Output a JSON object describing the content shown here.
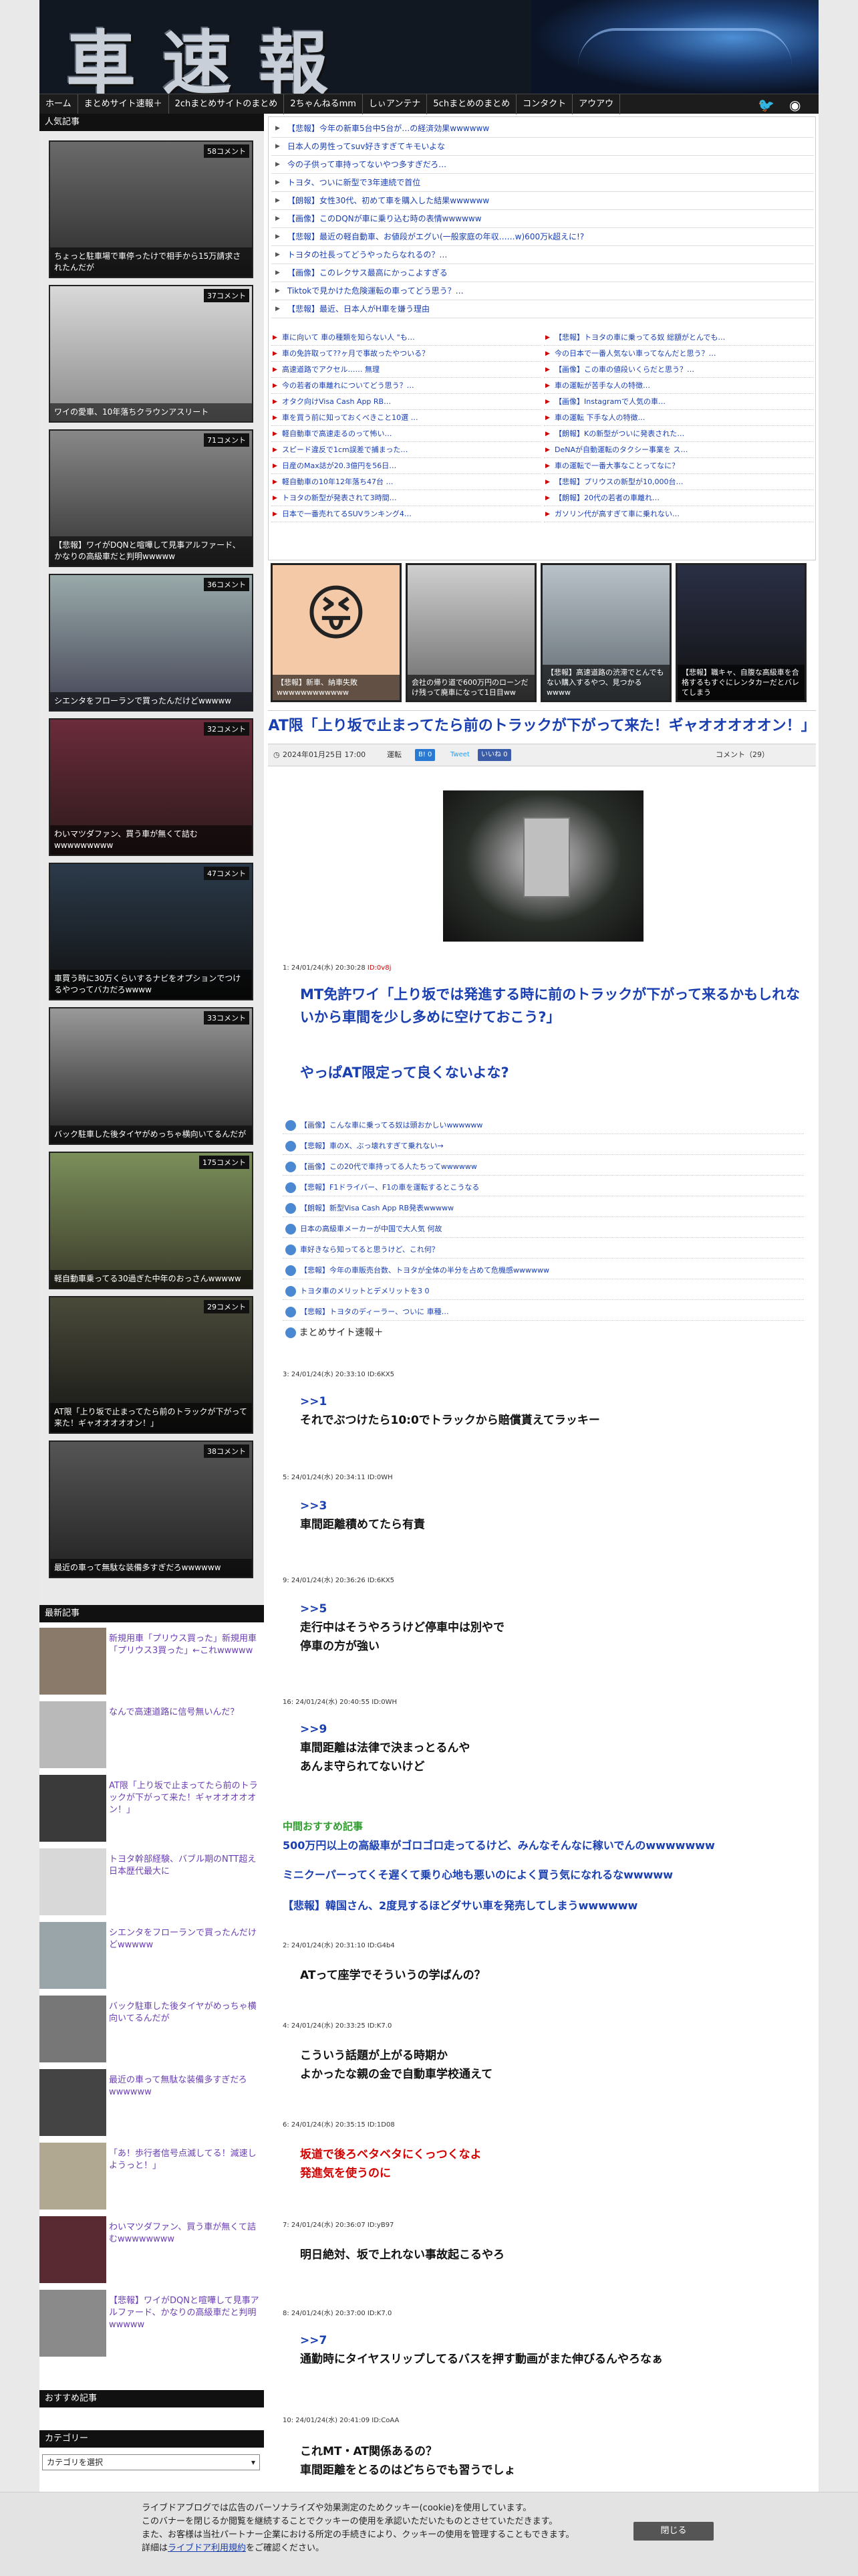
{
  "site": {
    "title": "車速報"
  },
  "nav": [
    "ホーム",
    "まとめサイト速報＋",
    "2chまとめサイトのまとめ",
    "2ちゃんねるmm",
    "しぃアンテナ",
    "5chまとめのまとめ",
    "コンタクト",
    "アウアウ"
  ],
  "ranking": {
    "heading": "人気記事",
    "items": [
      {
        "count": "58コメント",
        "caption": "ちょっと駐車場で車停ったけで相手から15万請求されたんだが"
      },
      {
        "count": "37コメント",
        "caption": "ワイの愛車、10年落ちクラウンアスリート"
      },
      {
        "count": "71コメント",
        "caption": "【悲報】ワイがDQNと喧嘩して見事アルファード、かなりの高級車だと判明wwwww"
      },
      {
        "count": "36コメント",
        "caption": "シエンタをフローランで買ったんだけどwwwww"
      },
      {
        "count": "32コメント",
        "caption": "わいマツダファン、買う車が無くて詰むwwwwwwwww"
      },
      {
        "count": "47コメント",
        "caption": "車買う時に30万くらいするナビをオプションでつけるやつってバカだろwwww"
      },
      {
        "count": "33コメント",
        "caption": "バック駐車した後タイヤがめっちゃ横向いてるんだが"
      },
      {
        "count": "175コメント",
        "caption": "軽自動車乗ってる30過ぎた中年のおっさんwwwww"
      },
      {
        "count": "29コメント",
        "caption": "AT限「上り坂で止まってたら前のトラックが下がって来た！ギャオオオオオン！」"
      },
      {
        "count": "38コメント",
        "caption": "最近の車って無駄な装備多すぎだろwwwwww"
      }
    ]
  },
  "latest": {
    "heading": "最新記事",
    "items": [
      "新規用車「プリウス買った」新規用車「プリウス3買った」←これwwwww",
      "なんで高速道路に信号無いんだ？",
      "AT限「上り坂で止まってたら前のトラックが下がって来た！ギャオオオオオン！」",
      "トヨタ幹部経験、バブル期のNTT超え日本歴代最大に",
      "シエンタをフローランで買ったんだけどwwwww",
      "バック駐車した後タイヤがめっちゃ横向いてるんだが",
      "最近の車って無駄な装備多すぎだろwwwwww",
      "「あ！歩行者信号点滅してる！減速しようっと！」",
      "わいマツダファン、買う車が無くて詰むwwwwwwww",
      "【悲報】ワイがDQNと喧嘩して見事アルファード、かなりの高級車だと判明wwwww"
    ]
  },
  "recommend_heading": "おすすめ記事",
  "category": {
    "heading": "カテゴリー",
    "select": "カテゴリを選択"
  },
  "list1": [
    "【悲報】今年の新車5台中5台が…の経済効果wwwwww",
    "日本人の男性ってsuv好きすぎてキモいよな",
    "今の子供って車持ってないやつ多すぎだろ…",
    "トヨタ、ついに新型で3年連続で首位",
    "【朗報】女性30代、初めて車を購入した結果wwwwww",
    "【画像】このDQNが車に乗り込む時の表情wwwwww",
    "【悲報】最近の軽自動車、お値段がエグい(一般家庭の年収……w)600万k超えに!?",
    "トヨタの社長ってどうやったらなれるの？…",
    "【画像】このレクサス最高にかっこよすぎる",
    "Tiktokで見かけた危険運転の車ってどう思う？…",
    "【悲報】最近、日本人がH車を嫌う理由"
  ],
  "list2_left": [
    "車に向いて    車の種類を知らない人    \"も…",
    "車の免許取って??ヶ月で事故ったやついる？",
    "高速道路でアクセル…… 無理",
    "今の若者の車離れについてどう思う？…",
    "オタク向けVisa Cash App RB…",
    "車を買う前に知っておくべきこと10選    …",
    "軽自動車で高速走るのって怖い…",
    "スピード違反で1cm誤差で捕まった…",
    "日産のMax誌が20.3億円を56日…",
    "軽自動車の10年12年落ち47台    …",
    "トヨタの新型が発表されて3時間…",
    "日本で一番売れてるSUVランキング4…"
  ],
  "list2_right": [
    "【悲報】トヨタの車に乗ってる奴 総額がとんでも…",
    "今の日本で一番人気ない車ってなんだと思う？…",
    "【画像】この車の値段いくらだと思う？…",
    "車の運転が苦手な人の特徴…",
    "【画像】Instagramで人気の車…",
    "車の運転    下手な人の特徴…",
    "【朗報】Kの新型がついに発表された…",
    "DeNAが自動運転のタクシー事業を    ス…",
    "車の運転で一番大事なことってなに？",
    "【悲報】プリウスの新型が10,000台…",
    "【朗報】20代の若者の車離れ…",
    "ガソリン代が高すぎて車に乗れない…"
  ],
  "featured": [
    "【悲報】新車、納車失敗wwwwwwwwwwww",
    "会社の帰り道で600万円のローンだけ残って廃車になって1日目ww",
    "【悲報】高速道路の渋滞でとんでもない購入するやつ、見つかるwwww",
    "【悲報】職キャ、自腹な高級車を合格するもすぐにレンタカーだとバレてしまう"
  ],
  "article": {
    "title": "AT限「上り坂で止まってたら前のトラックが下がって来た！ギャオオオオオン！」",
    "date": "2024年01月25日 17:00",
    "category": "運転",
    "comment": "コメント（29）",
    "tweet": "Tweet",
    "share": "いいね 0",
    "b": "B! 0",
    "first_post_header": "1: 24/01/24(水) 20:30:28",
    "first_post_name": "ID:0v8j",
    "first_post_body_1": "MT免許ワイ「上り坂では発進する時に前のトラックが下がって来るかもしれないから車間を少し多めに空けておこう?」",
    "first_post_body_2": "やっぱAT限定って良くないよな?",
    "ad_links": [
      "【画像】こんな車に乗ってる奴は頭おかしいwwwwww",
      "【悲報】車のX、ぶっ壊れすぎて乗れない→",
      "【画像】この20代で車持ってる人たちってwwwwww",
      "【悲報】F1ドライバー、F1の車を運転するとこうなる",
      "【朗報】新型Visa Cash App RB発表wwwww",
      "日本の高級車メーカーが中国で大人気    何故",
      "車好きなら知ってると思うけど、これ何？",
      "【悲報】今年の車販売台数、トヨタが全体の半分を占めて危機感wwwwww",
      "トヨタ車のメリットとデメリットを3    0",
      "【悲報】トヨタのディーラー、ついに    車種…"
    ],
    "matome_label": "まとめサイト速報＋",
    "posts": [
      {
        "header": "3: 24/01/24(水) 20:33:10 ID:6KX5",
        "body": [
          ">>1",
          "それでぶつけたら10:0でトラックから賠償貰えてラッキー"
        ]
      },
      {
        "header": "5: 24/01/24(水) 20:34:11 ID:0WH",
        "body": [
          ">>3",
          "車間距離積めてたら有責"
        ]
      },
      {
        "header": "9: 24/01/24(水) 20:36:26 ID:6KX5",
        "body": [
          ">>5",
          "走行中はそうやろうけど停車中は別やで",
          "停車の方が強い"
        ]
      },
      {
        "header": "16: 24/01/24(水) 20:40:55 ID:0WH",
        "body": [
          ">>9",
          "車間距離は法律で決まっとるんや",
          "あんま守られてないけど"
        ]
      }
    ],
    "recommend_green": "中間おすすめ記事",
    "recommend_links": [
      "500万円以上の高級車がゴロゴロ走ってるけど、みんなそんなに稼いでんのwwwwwww",
      "ミニクーパーってくそ遅くて乗り心地も悪いのによく買う気になれるなwwwww",
      "【悲報】韓国さん、2度見するほどダサい車を発売してしまうwwwwww"
    ],
    "posts2": [
      {
        "header": "2: 24/01/24(水) 20:31:10 ID:G4b4",
        "body": [
          "ATって座学でそういうの学ばんの？"
        ],
        "red": false
      },
      {
        "header": "4: 24/01/24(水) 20:33:25 ID:K7.0",
        "body": [
          "こういう話題が上がる時期か",
          "よかったな親の金で自動車学校通えて"
        ],
        "red": false
      },
      {
        "header": "6: 24/01/24(水) 20:35:15 ID:1D08",
        "body": [
          "坂道で後ろベタベタにくっつくなよ",
          "発進気を使うのに"
        ],
        "red": true
      },
      {
        "header": "7: 24/01/24(水) 20:36:07 ID:yB97",
        "body": [
          "明日絶対、坂で上れない事故起こるやろ"
        ],
        "red": false
      },
      {
        "header": "8: 24/01/24(水) 20:37:00 ID:K7.0",
        "body": [
          ">>7",
          "通勤時にタイヤスリップしてるバスを押す動画がまた伸びるんやろなぁ"
        ],
        "red": false
      },
      {
        "header": "10: 24/01/24(水) 20:41:09 ID:CoAA",
        "body": [
          "これMT・AT関係あるの？",
          "車間距離をとるのはどちらでも習うでしょ"
        ],
        "red": false
      }
    ]
  },
  "cookie": {
    "line1": "ライブドアブログでは広告のパーソナライズや効果測定のためクッキー(cookie)を使用しています。",
    "line2": "このバナーを閉じるか閲覧を継続することでクッキーの使用を承認いただいたものとさせていただきます。",
    "line3": "また、お客様は当社パートナー企業における所定の手続きにより、クッキーの使用を管理することもできます。",
    "line4_pre": "詳細は",
    "line4_link": "ライブドア利用規約",
    "line4_post": "をご確認ください。",
    "close": "閉じる"
  }
}
